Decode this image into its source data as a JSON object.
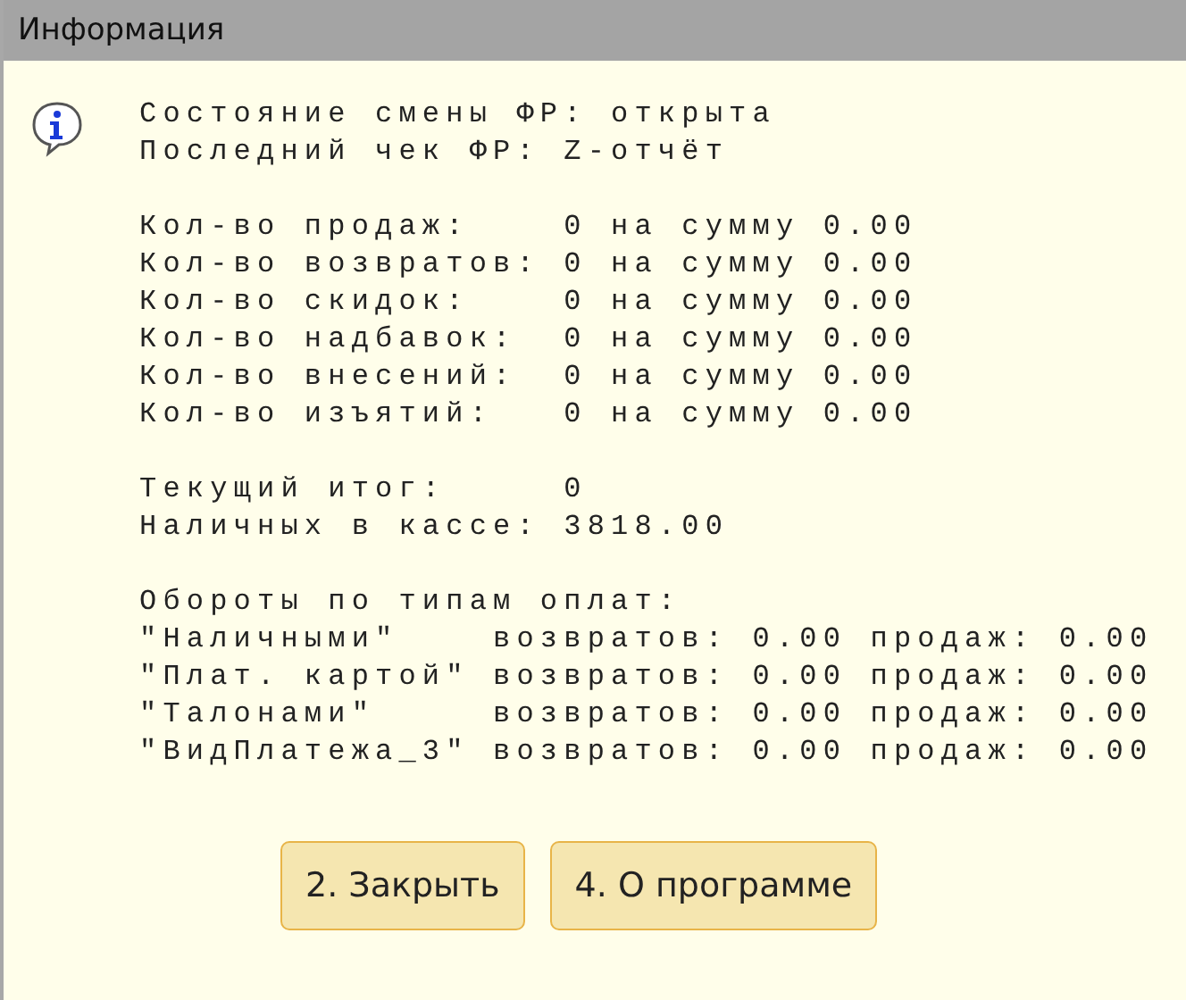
{
  "window": {
    "title": "Информация"
  },
  "blocks": [
    {
      "lines": [
        "Состояние смены ФР: открыта",
        "Последний чек ФР: Z-отчёт"
      ]
    },
    {
      "lines": [
        "Кол-во продаж:    0 на сумму 0.00",
        "Кол-во возвратов: 0 на сумму 0.00",
        "Кол-во скидок:    0 на сумму 0.00",
        "Кол-во надбавок:  0 на сумму 0.00",
        "Кол-во внесений:  0 на сумму 0.00",
        "Кол-во изъятий:   0 на сумму 0.00"
      ]
    },
    {
      "lines": [
        "Текущий итог:     0",
        "Наличных в кассе: 3818.00"
      ]
    },
    {
      "lines": [
        "Обороты по типам оплат:",
        "\"Наличными\"    возвратов: 0.00 продаж: 0.00",
        "\"Плат. картой\" возвратов: 0.00 продаж: 0.00",
        "\"Талонами\"     возвратов: 0.00 продаж: 0.00",
        "\"ВидПлатежа_3\" возвратов: 0.00 продаж: 0.00"
      ]
    }
  ],
  "buttons": [
    "2. Закрыть",
    "4. О программе"
  ]
}
